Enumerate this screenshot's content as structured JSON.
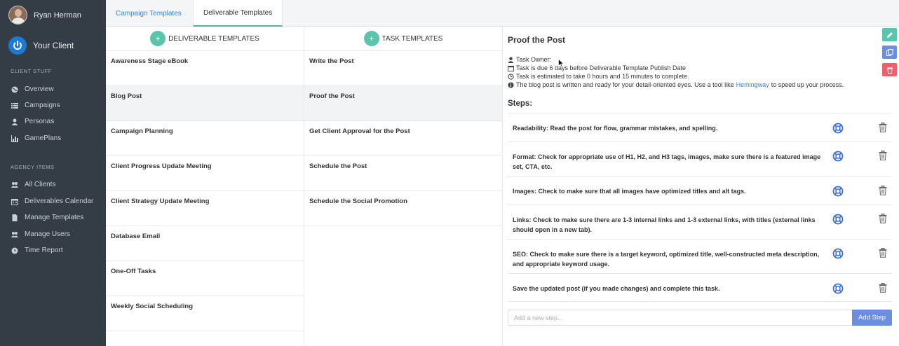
{
  "user": {
    "name": "Ryan Herman"
  },
  "client": {
    "name": "Your Client"
  },
  "sidebar": {
    "client_section": "CLIENT STUFF",
    "client_items": [
      {
        "label": "Overview",
        "icon": "globe-icon"
      },
      {
        "label": "Campaigns",
        "icon": "list-icon"
      },
      {
        "label": "Personas",
        "icon": "user-icon"
      },
      {
        "label": "GamePlans",
        "icon": "bar-chart-icon"
      }
    ],
    "agency_section": "AGENCY ITEMS",
    "agency_items": [
      {
        "label": "All Clients",
        "icon": "users-icon"
      },
      {
        "label": "Deliverables Calendar",
        "icon": "calendar-icon"
      },
      {
        "label": "Manage Templates",
        "icon": "file-icon"
      },
      {
        "label": "Manage Users",
        "icon": "users-icon"
      },
      {
        "label": "Time Report",
        "icon": "clock-icon"
      }
    ]
  },
  "tabs": [
    {
      "label": "Campaign Templates",
      "active": false
    },
    {
      "label": "Deliverable Templates",
      "active": true
    }
  ],
  "deliverables": {
    "header": "DELIVERABLE TEMPLATES",
    "items": [
      "Awareness Stage eBook",
      "Blog Post",
      "Campaign Planning",
      "Client Progress Update Meeting",
      "Client Strategy Update Meeting",
      "Database Email",
      "One-Off Tasks",
      "Weekly Social Scheduling"
    ],
    "selected": 1
  },
  "tasks": {
    "header": "TASK TEMPLATES",
    "items": [
      "Write the Post",
      "Proof the Post",
      "Get Client Approval for the Post",
      "Schedule the Post",
      "Schedule the Social Promotion"
    ],
    "selected": 1
  },
  "detail": {
    "title": "Proof the Post",
    "owner": "Task Owner:",
    "due": "Task is due 6 days before Deliverable Template Publish Date",
    "estimate": "Task is estimated to take 0 hours and 15 minutes to complete.",
    "description_pre": "The blog post is written and ready for your detail-oriented eyes. Use a tool like",
    "description_link": "Hemingway",
    "description_post": "to speed up your process.",
    "steps_label": "Steps:",
    "steps": [
      "Readability: Read the post for flow, grammar mistakes, and spelling.",
      "Format: Check for appropriate use of H1, H2, and H3 tags, images, make sure there is a featured image set, CTA, etc.",
      "Images: Check to make sure that all images have optimized titles and alt tags.",
      "Links: Check to make sure there are 1-3 internal links and 1-3 external links, with titles (external links should open in a new tab).",
      "SEO: Check to make sure there is a target keyword, optimized title, well-constructed meta description, and appropriate keyword usage.",
      "Save the updated post (if you made changes) and complete this task."
    ],
    "new_step_placeholder": "Add a new step...",
    "add_step_label": "Add Step"
  },
  "colors": {
    "sidebar_bg": "#343c45",
    "accent_teal": "#5cc4ad",
    "link_blue": "#3b84d8",
    "edit_green": "#5cc4ad",
    "copy_blue": "#6b8fde",
    "delete_red": "#e8636a"
  }
}
